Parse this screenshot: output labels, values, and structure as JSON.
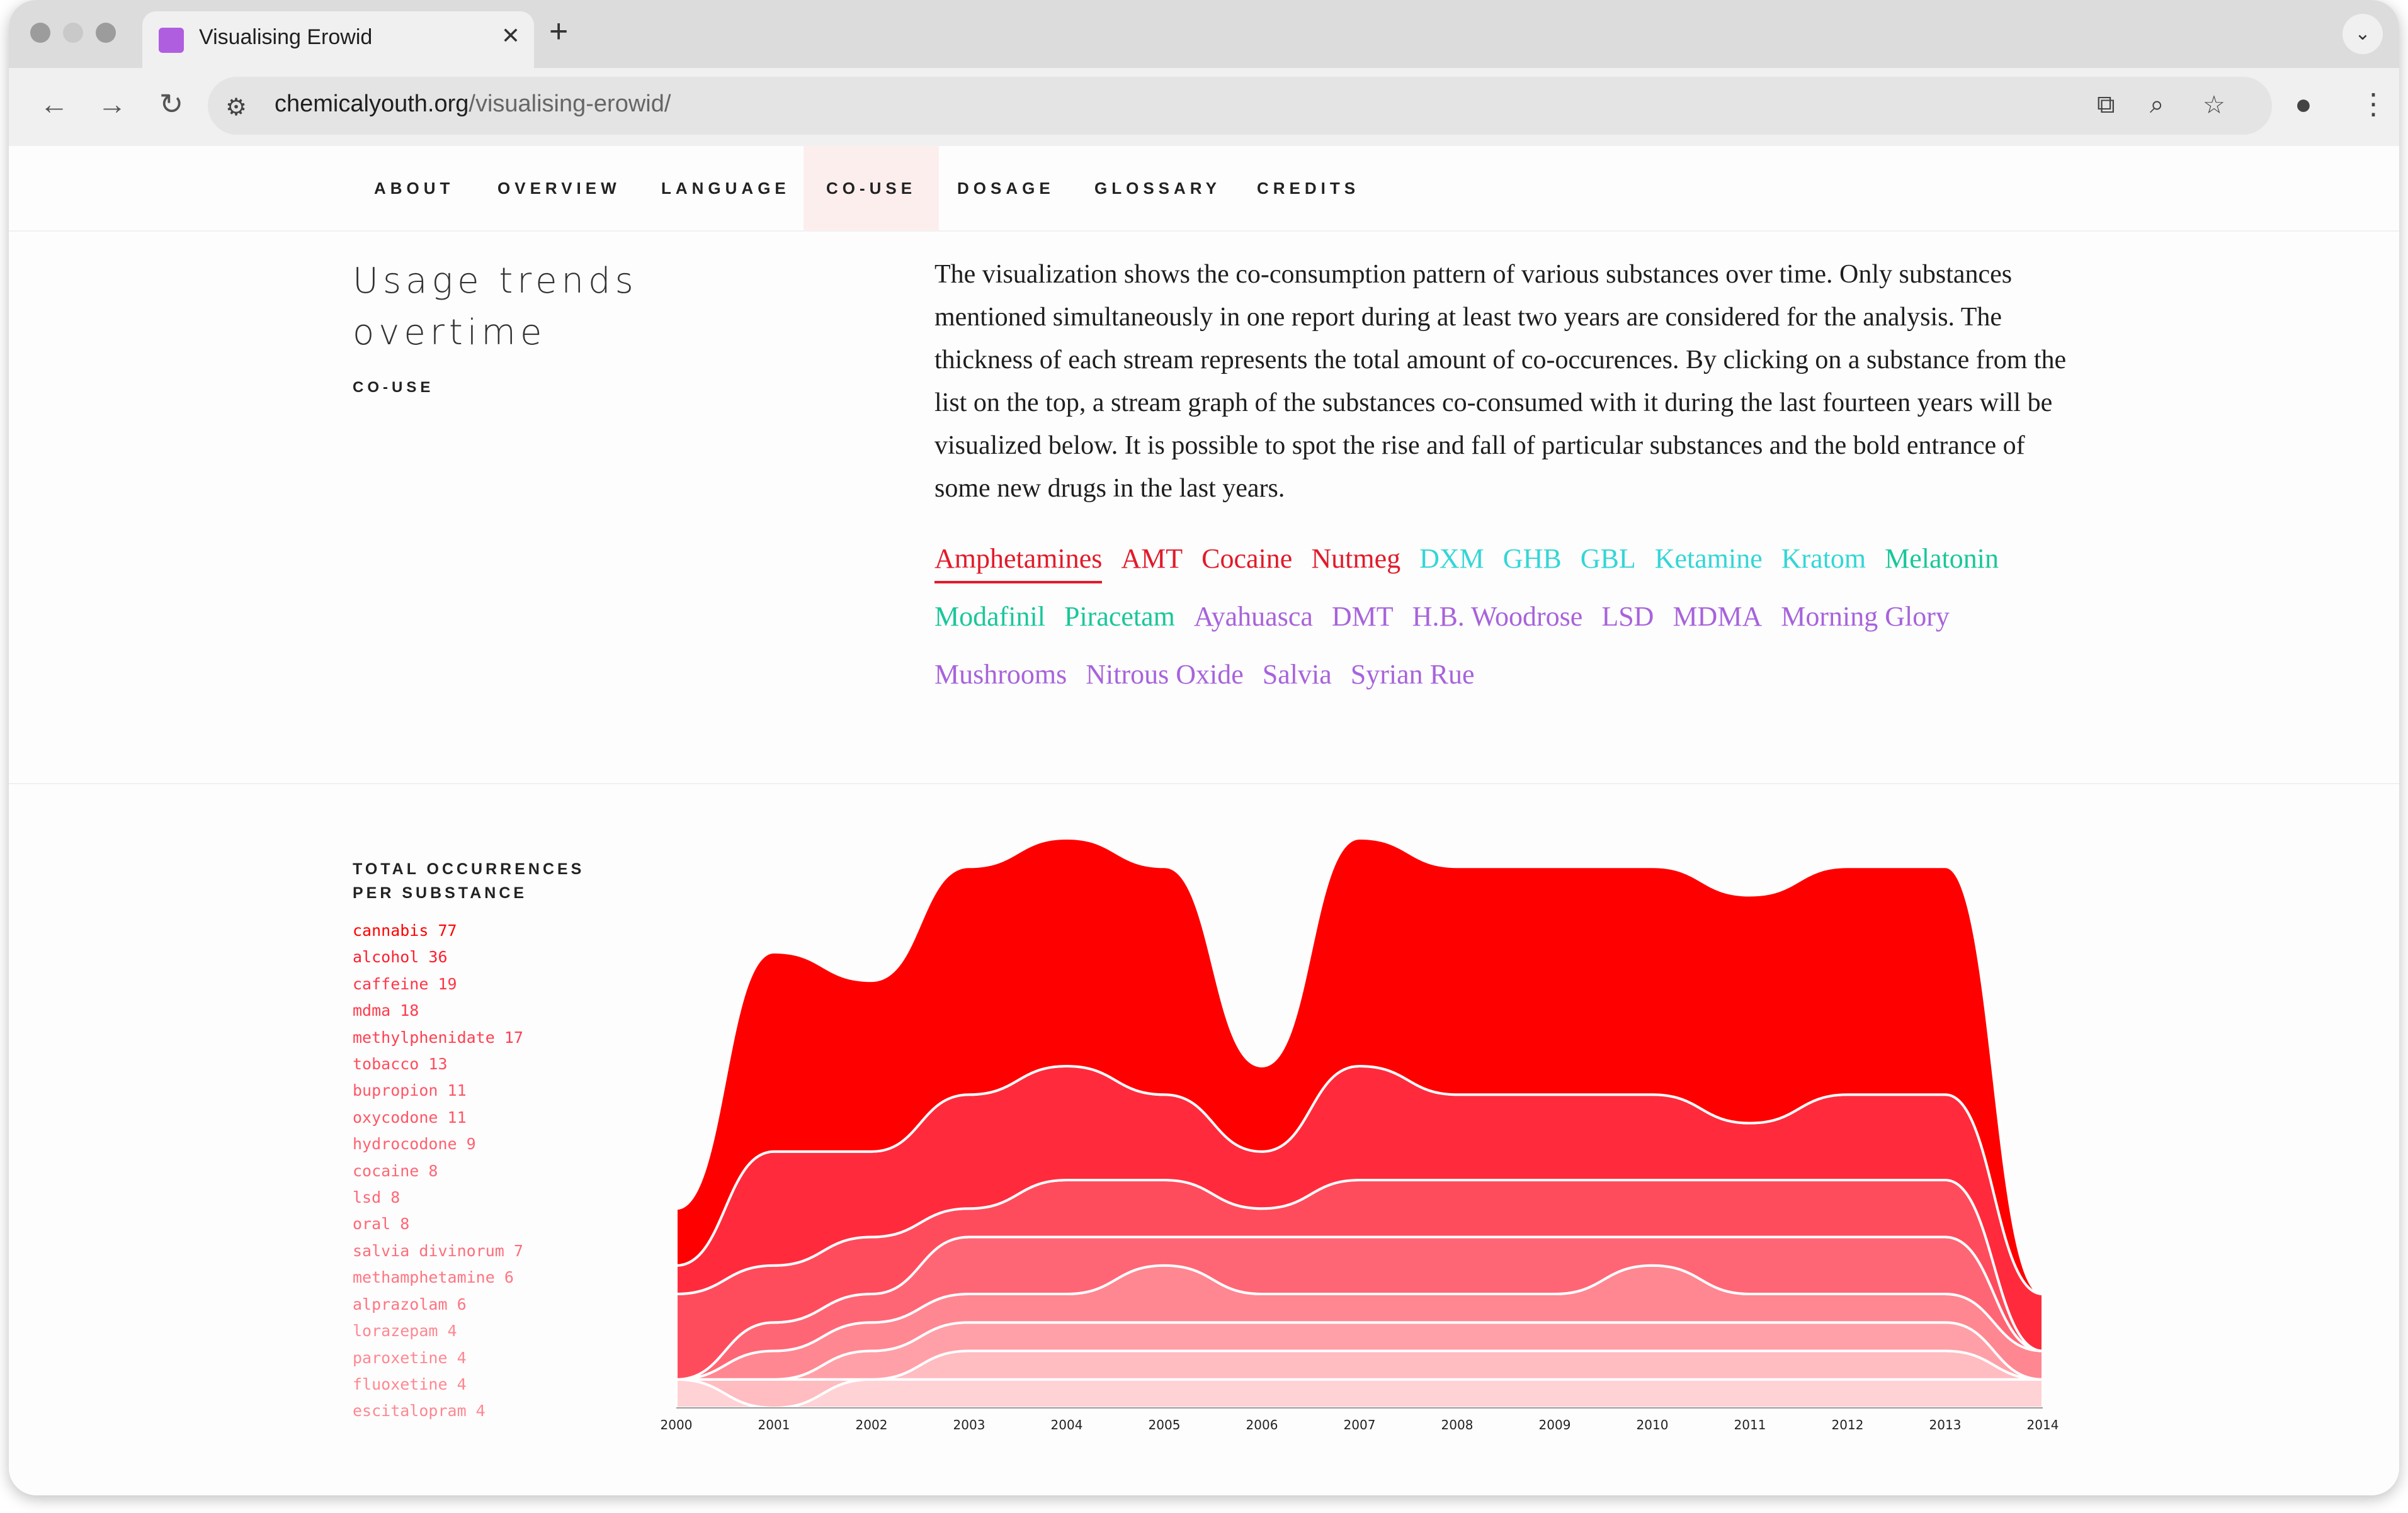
{
  "browser": {
    "tab_title": "Visualising Erowid",
    "tab_close": "✕",
    "new_tab": "+",
    "url_host": "chemicalyouth.org",
    "url_path": "/visualising-erowid/",
    "icons": [
      "back-icon",
      "forward-icon",
      "reload-icon",
      "site-settings-icon",
      "translate-icon",
      "zoom-icon",
      "bookmark-star-icon",
      "profile-icon",
      "menu-icon"
    ]
  },
  "nav": {
    "items": [
      "ABOUT",
      "OVERVIEW",
      "LANGUAGE",
      "CO-USE",
      "DOSAGE",
      "GLOSSARY",
      "CREDITS"
    ],
    "active": "CO-USE"
  },
  "section": {
    "title": "Usage trends overtime",
    "subtitle": "CO-USE",
    "description": "The visualization shows the co-consumption pattern of various substances over time. Only substances mentioned simultaneously in one report during at least two years are considered for the analysis. The thickness of each stream represents the total amount of co-occurences. By clicking on a substance from the list on the top, a stream graph of the substances co-consumed with it during the last fourteen years will be visualized below. It is possible to spot the rise and fall of particular substances and the bold entrance of some new drugs in the last years."
  },
  "substances": [
    {
      "name": "Amphetamines",
      "color": "#e21a2a",
      "selected": true
    },
    {
      "name": "AMT",
      "color": "#e21a2a"
    },
    {
      "name": "Cocaine",
      "color": "#e21a2a"
    },
    {
      "name": "Nutmeg",
      "color": "#e21a2a"
    },
    {
      "name": "DXM",
      "color": "#33d6d6"
    },
    {
      "name": "GHB",
      "color": "#33d6d6"
    },
    {
      "name": "GBL",
      "color": "#33d6d6"
    },
    {
      "name": "Ketamine",
      "color": "#33d6d6"
    },
    {
      "name": "Kratom",
      "color": "#33d6d6"
    },
    {
      "name": "Melatonin",
      "color": "#19c79a"
    },
    {
      "name": "Modafinil",
      "color": "#19c79a"
    },
    {
      "name": "Piracetam",
      "color": "#19c79a"
    },
    {
      "name": "Ayahuasca",
      "color": "#a763dc"
    },
    {
      "name": "DMT",
      "color": "#a763dc"
    },
    {
      "name": "H.B. Woodrose",
      "color": "#a763dc"
    },
    {
      "name": "LSD",
      "color": "#a763dc"
    },
    {
      "name": "MDMA",
      "color": "#a763dc"
    },
    {
      "name": "Morning Glory",
      "color": "#a763dc"
    },
    {
      "name": "Mushrooms",
      "color": "#a763dc"
    },
    {
      "name": "Nitrous Oxide",
      "color": "#a763dc"
    },
    {
      "name": "Salvia",
      "color": "#a763dc"
    },
    {
      "name": "Syrian Rue",
      "color": "#a763dc"
    }
  ],
  "occurrences": {
    "title_line1": "TOTAL OCCURRENCES",
    "title_line2": "PER SUBSTANCE",
    "items": [
      {
        "label": "cannabis 77",
        "color": "#ff0000"
      },
      {
        "label": "alcohol 36",
        "color": "#ff1e2e"
      },
      {
        "label": "caffeine 19",
        "color": "#ff3447"
      },
      {
        "label": "mdma 18",
        "color": "#ff3a4c"
      },
      {
        "label": "methylphenidate 17",
        "color": "#ff3f51"
      },
      {
        "label": "tobacco 13",
        "color": "#ff4c5d"
      },
      {
        "label": "bupropion 11",
        "color": "#ff5666"
      },
      {
        "label": "oxycodone 11",
        "color": "#ff5666"
      },
      {
        "label": "hydrocodone 9",
        "color": "#ff6070"
      },
      {
        "label": "cocaine 8",
        "color": "#ff6675"
      },
      {
        "label": "lsd 8",
        "color": "#ff6675"
      },
      {
        "label": "oral 8",
        "color": "#ff6675"
      },
      {
        "label": "salvia divinorum 7",
        "color": "#ff6d7b"
      },
      {
        "label": "methamphetamine 6",
        "color": "#ff7482"
      },
      {
        "label": "alprazolam 6",
        "color": "#ff7482"
      },
      {
        "label": "lorazepam 4",
        "color": "#ff8791"
      },
      {
        "label": "paroxetine 4",
        "color": "#ff8791"
      },
      {
        "label": "fluoxetine 4",
        "color": "#ff8791"
      },
      {
        "label": "escitalopram 4",
        "color": "#ff8791"
      }
    ]
  },
  "chart_data": {
    "type": "area",
    "x": [
      2000,
      2001,
      2002,
      2003,
      2004,
      2005,
      2006,
      2007,
      2008,
      2009,
      2010,
      2011,
      2012,
      2013,
      2014
    ],
    "xlabel": "",
    "ylabel": "",
    "grid": false,
    "legend": "none",
    "series": [
      {
        "values": [
          2,
          7,
          6,
          8,
          8,
          8,
          3,
          8,
          8,
          8,
          8,
          8,
          8,
          8,
          0
        ],
        "color": "#ff0000"
      },
      {
        "values": [
          1,
          4,
          3,
          4,
          4,
          3,
          2,
          4,
          3,
          3,
          3,
          2,
          3,
          3,
          2
        ],
        "color": "#ff2b3d"
      },
      {
        "values": [
          3,
          2,
          2,
          1,
          2,
          2,
          1,
          2,
          2,
          2,
          2,
          2,
          2,
          2,
          0
        ],
        "color": "#ff4c5d"
      },
      {
        "values": [
          0,
          1,
          1,
          2,
          2,
          1,
          2,
          2,
          2,
          2,
          1,
          2,
          2,
          2,
          0
        ],
        "color": "#ff6675"
      },
      {
        "values": [
          0,
          1,
          1,
          1,
          1,
          2,
          1,
          1,
          1,
          1,
          2,
          1,
          1,
          1,
          1
        ],
        "color": "#ff8791"
      },
      {
        "values": [
          0,
          0,
          1,
          1,
          1,
          1,
          1,
          1,
          1,
          1,
          1,
          1,
          1,
          1,
          0
        ],
        "color": "#ffa0a8"
      },
      {
        "values": [
          0,
          1,
          0,
          1,
          1,
          1,
          1,
          1,
          1,
          1,
          1,
          1,
          1,
          1,
          0
        ],
        "color": "#ffbcc1"
      },
      {
        "values": [
          1,
          0,
          1,
          1,
          1,
          1,
          1,
          1,
          1,
          1,
          1,
          1,
          1,
          1,
          1
        ],
        "color": "#ffd2d5"
      }
    ]
  }
}
